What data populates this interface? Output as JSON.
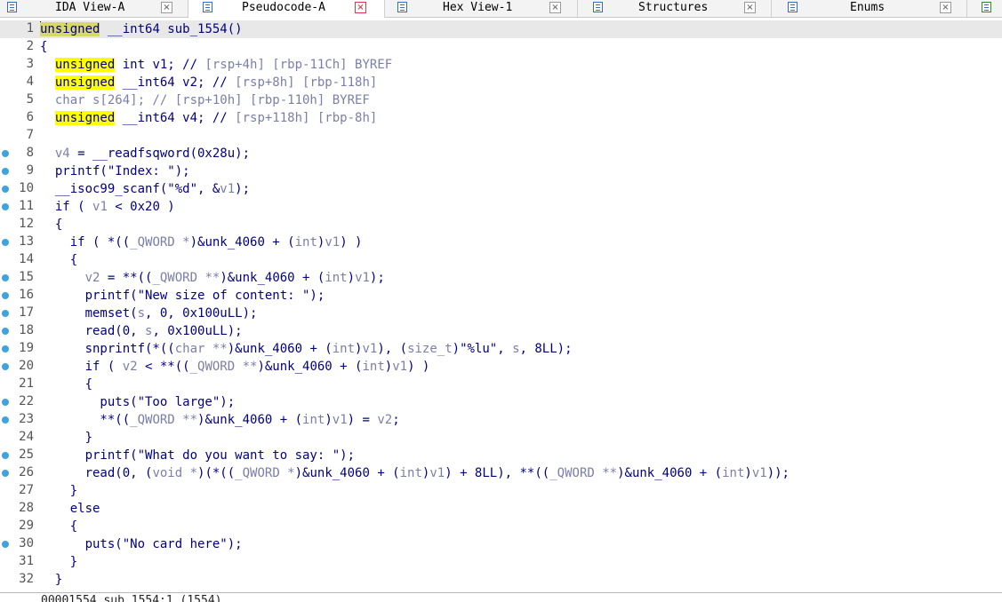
{
  "tabs": [
    {
      "label": "IDA View-A",
      "close": "×",
      "icon": "disassembly-view-icon",
      "active": false
    },
    {
      "label": "Pseudocode-A",
      "close": "×",
      "icon": "pseudocode-view-icon",
      "active": true
    },
    {
      "label": "Hex View-1",
      "close": "×",
      "icon": "hex-view-icon",
      "active": false
    },
    {
      "label": "Structures",
      "close": "×",
      "icon": "structures-icon",
      "active": false
    },
    {
      "label": "Enums",
      "close": "×",
      "icon": "enums-icon",
      "active": false
    }
  ],
  "colors": {
    "keyword": "#000080",
    "highlight": "#ffff00",
    "comment": "#7b7fa8",
    "breakpoint_dot": "#3ea3e0",
    "current_line": "#e8e8e8"
  },
  "code": {
    "lines": [
      {
        "n": "1",
        "dot": false,
        "tokens": [
          [
            "hlcur",
            "unsigned"
          ],
          [
            "kw",
            " __int64 sub_1554()"
          ]
        ]
      },
      {
        "n": "2",
        "dot": false,
        "tokens": [
          [
            "kw",
            "{"
          ]
        ]
      },
      {
        "n": "3",
        "dot": false,
        "tokens": [
          [
            "kw",
            "  "
          ],
          [
            "hl",
            "unsigned"
          ],
          [
            "kw",
            " int v1; // "
          ],
          [
            "gray",
            "[rsp+4h] [rbp-11Ch] BYREF"
          ]
        ]
      },
      {
        "n": "4",
        "dot": false,
        "tokens": [
          [
            "kw",
            "  "
          ],
          [
            "hl",
            "unsigned"
          ],
          [
            "kw",
            " __int64 v2; // "
          ],
          [
            "gray",
            "[rsp+8h] [rbp-118h]"
          ]
        ]
      },
      {
        "n": "5",
        "dot": false,
        "tokens": [
          [
            "gray",
            "  char s[264]; // [rsp+10h] [rbp-110h] BYREF"
          ]
        ]
      },
      {
        "n": "6",
        "dot": false,
        "tokens": [
          [
            "kw",
            "  "
          ],
          [
            "hl",
            "unsigned"
          ],
          [
            "kw",
            " __int64 v4; // "
          ],
          [
            "gray",
            "[rsp+118h] [rbp-8h]"
          ]
        ]
      },
      {
        "n": "7",
        "dot": false,
        "tokens": [
          [
            "kw",
            ""
          ]
        ]
      },
      {
        "n": "8",
        "dot": true,
        "tokens": [
          [
            "gray",
            "  v4"
          ],
          [
            "kw",
            " = __readfsqword(0x28u);"
          ]
        ]
      },
      {
        "n": "9",
        "dot": true,
        "tokens": [
          [
            "kw",
            "  printf(\"Index: \");"
          ]
        ]
      },
      {
        "n": "10",
        "dot": true,
        "tokens": [
          [
            "kw",
            "  __isoc99_scanf(\"%d\", &"
          ],
          [
            "gray",
            "v1"
          ],
          [
            "kw",
            ");"
          ]
        ]
      },
      {
        "n": "11",
        "dot": true,
        "tokens": [
          [
            "kw",
            "  if ( "
          ],
          [
            "gray",
            "v1"
          ],
          [
            "kw",
            " < 0x20 )"
          ]
        ]
      },
      {
        "n": "12",
        "dot": false,
        "tokens": [
          [
            "kw",
            "  {"
          ]
        ]
      },
      {
        "n": "13",
        "dot": true,
        "tokens": [
          [
            "kw",
            "    if ( *(("
          ],
          [
            "gray",
            "_QWORD *"
          ],
          [
            "kw",
            ")&unk_4060 + ("
          ],
          [
            "gray",
            "int"
          ],
          [
            "kw",
            ")"
          ],
          [
            "gray",
            "v1"
          ],
          [
            "kw",
            ") )"
          ]
        ]
      },
      {
        "n": "14",
        "dot": false,
        "tokens": [
          [
            "kw",
            "    {"
          ]
        ]
      },
      {
        "n": "15",
        "dot": true,
        "tokens": [
          [
            "kw",
            "      "
          ],
          [
            "gray",
            "v2"
          ],
          [
            "kw",
            " = **(("
          ],
          [
            "gray",
            "_QWORD **"
          ],
          [
            "kw",
            ")&unk_4060 + ("
          ],
          [
            "gray",
            "int"
          ],
          [
            "kw",
            ")"
          ],
          [
            "gray",
            "v1"
          ],
          [
            "kw",
            ");"
          ]
        ]
      },
      {
        "n": "16",
        "dot": true,
        "tokens": [
          [
            "kw",
            "      printf(\"New size of content: \");"
          ]
        ]
      },
      {
        "n": "17",
        "dot": true,
        "tokens": [
          [
            "kw",
            "      memset("
          ],
          [
            "gray",
            "s"
          ],
          [
            "kw",
            ", 0, 0x100uLL);"
          ]
        ]
      },
      {
        "n": "18",
        "dot": true,
        "tokens": [
          [
            "kw",
            "      read(0, "
          ],
          [
            "gray",
            "s"
          ],
          [
            "kw",
            ", 0x100uLL);"
          ]
        ]
      },
      {
        "n": "19",
        "dot": true,
        "tokens": [
          [
            "kw",
            "      snprintf(*(("
          ],
          [
            "gray",
            "char **"
          ],
          [
            "kw",
            ")&unk_4060 + ("
          ],
          [
            "gray",
            "int"
          ],
          [
            "kw",
            ")"
          ],
          [
            "gray",
            "v1"
          ],
          [
            "kw",
            "), ("
          ],
          [
            "gray",
            "size_t"
          ],
          [
            "kw",
            ")\"%lu\", "
          ],
          [
            "gray",
            "s"
          ],
          [
            "kw",
            ", 8LL);"
          ]
        ]
      },
      {
        "n": "20",
        "dot": true,
        "tokens": [
          [
            "kw",
            "      if ( "
          ],
          [
            "gray",
            "v2"
          ],
          [
            "kw",
            " < **(("
          ],
          [
            "gray",
            "_QWORD **"
          ],
          [
            "kw",
            ")&unk_4060 + ("
          ],
          [
            "gray",
            "int"
          ],
          [
            "kw",
            ")"
          ],
          [
            "gray",
            "v1"
          ],
          [
            "kw",
            ") )"
          ]
        ]
      },
      {
        "n": "21",
        "dot": false,
        "tokens": [
          [
            "kw",
            "      {"
          ]
        ]
      },
      {
        "n": "22",
        "dot": true,
        "tokens": [
          [
            "kw",
            "        puts(\"Too large\");"
          ]
        ]
      },
      {
        "n": "23",
        "dot": true,
        "tokens": [
          [
            "kw",
            "        **(("
          ],
          [
            "gray",
            "_QWORD **"
          ],
          [
            "kw",
            ")&unk_4060 + ("
          ],
          [
            "gray",
            "int"
          ],
          [
            "kw",
            ")"
          ],
          [
            "gray",
            "v1"
          ],
          [
            "kw",
            ") = "
          ],
          [
            "gray",
            "v2"
          ],
          [
            "kw",
            ";"
          ]
        ]
      },
      {
        "n": "24",
        "dot": false,
        "tokens": [
          [
            "kw",
            "      }"
          ]
        ]
      },
      {
        "n": "25",
        "dot": true,
        "tokens": [
          [
            "kw",
            "      printf(\"What do you want to say: \");"
          ]
        ]
      },
      {
        "n": "26",
        "dot": true,
        "tokens": [
          [
            "kw",
            "      read(0, ("
          ],
          [
            "gray",
            "void *"
          ],
          [
            "kw",
            ")(*(("
          ],
          [
            "gray",
            "_QWORD *"
          ],
          [
            "kw",
            ")&unk_4060 + ("
          ],
          [
            "gray",
            "int"
          ],
          [
            "kw",
            ")"
          ],
          [
            "gray",
            "v1"
          ],
          [
            "kw",
            ") + 8LL), **(("
          ],
          [
            "gray",
            "_QWORD **"
          ],
          [
            "kw",
            ")&unk_4060 + ("
          ],
          [
            "gray",
            "int"
          ],
          [
            "kw",
            ")"
          ],
          [
            "gray",
            "v1"
          ],
          [
            "kw",
            "));"
          ]
        ]
      },
      {
        "n": "27",
        "dot": false,
        "tokens": [
          [
            "kw",
            "    }"
          ]
        ]
      },
      {
        "n": "28",
        "dot": false,
        "tokens": [
          [
            "kw",
            "    else"
          ]
        ]
      },
      {
        "n": "29",
        "dot": false,
        "tokens": [
          [
            "kw",
            "    {"
          ]
        ]
      },
      {
        "n": "30",
        "dot": true,
        "tokens": [
          [
            "kw",
            "      puts(\"No card here\");"
          ]
        ]
      },
      {
        "n": "31",
        "dot": false,
        "tokens": [
          [
            "kw",
            "    }"
          ]
        ]
      },
      {
        "n": "32",
        "dot": false,
        "tokens": [
          [
            "kw",
            "  }"
          ]
        ]
      }
    ]
  },
  "status": {
    "text": "00001554 sub_1554:1 (1554)"
  }
}
